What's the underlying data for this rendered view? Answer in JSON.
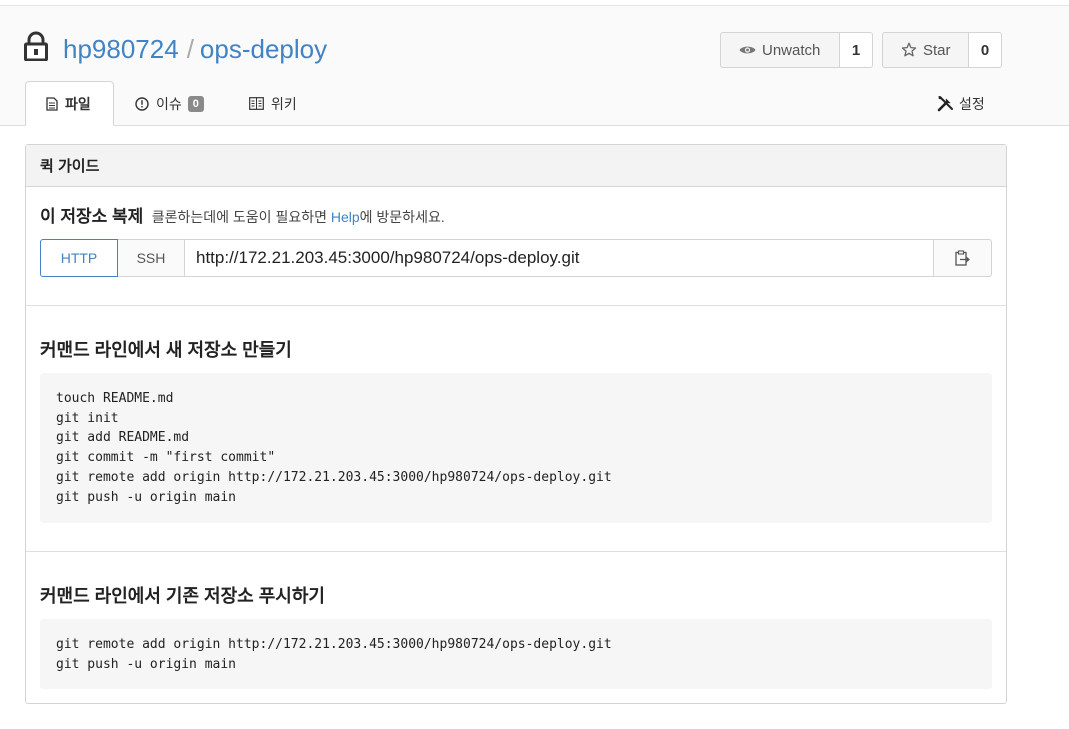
{
  "repo": {
    "owner": "hp980724",
    "separator": "/",
    "name": "ops-deploy"
  },
  "actions": {
    "watch": {
      "label": "Unwatch",
      "count": "1"
    },
    "star": {
      "label": "Star",
      "count": "0"
    }
  },
  "tabs": {
    "files": {
      "label": "파일"
    },
    "issues": {
      "label": "이슈",
      "count": "0"
    },
    "wiki": {
      "label": "위키"
    },
    "settings": {
      "label": "설정"
    }
  },
  "quick_guide": {
    "header": "퀵 가이드",
    "clone_title": "이 저장소 복제",
    "clone_hint_before": "클론하는데에 도움이 필요하면 ",
    "clone_hint_link": "Help",
    "clone_hint_after": "에 방문하세요.",
    "protocol_http": "HTTP",
    "protocol_ssh": "SSH",
    "clone_url": "http://172.21.203.45:3000/hp980724/ops-deploy.git",
    "new_repo_title": "커맨드 라인에서 새 저장소 만들기",
    "new_repo_code": "touch README.md\ngit init\ngit add README.md\ngit commit -m \"first commit\"\ngit remote add origin http://172.21.203.45:3000/hp980724/ops-deploy.git\ngit push -u origin main",
    "push_existing_title": "커맨드 라인에서 기존 저장소 푸시하기",
    "push_existing_code": "git remote add origin http://172.21.203.45:3000/hp980724/ops-deploy.git\ngit push -u origin main"
  },
  "icons": {
    "lock": "lock-icon",
    "eye": "eye-icon",
    "star": "star-icon",
    "file": "file-icon",
    "issue": "issue-icon",
    "wiki": "book-icon",
    "settings": "tools-icon",
    "copy": "clipboard-icon"
  },
  "colors": {
    "link": "#4183c4",
    "header_bg": "#fafafa",
    "code_bg": "#f6f6f6"
  }
}
